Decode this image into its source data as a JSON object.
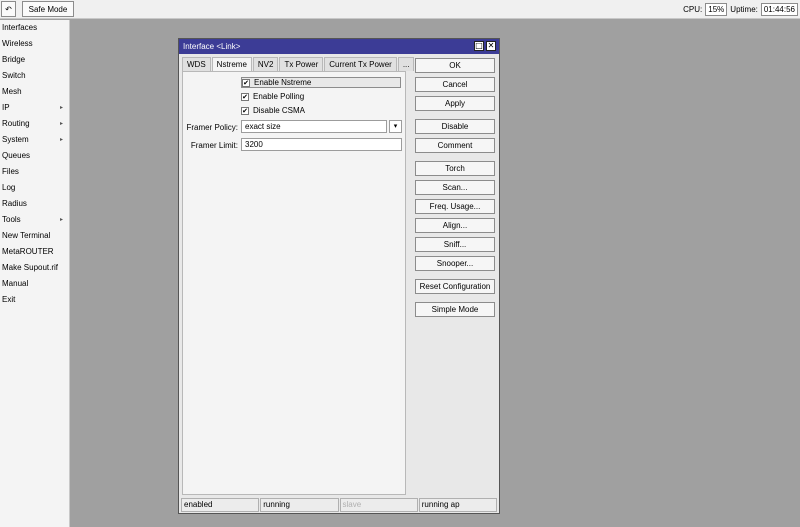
{
  "toolbar": {
    "undo_icon": "undo-icon",
    "undo_glyph": "↶",
    "safe_mode_label": "Safe Mode",
    "cpu_label": "CPU:",
    "cpu_value": "15%",
    "uptime_label": "Uptime:",
    "uptime_value": "01:44:56"
  },
  "sidebar": {
    "items": [
      {
        "label": "Interfaces",
        "submenu": false
      },
      {
        "label": "Wireless",
        "submenu": false
      },
      {
        "label": "Bridge",
        "submenu": false
      },
      {
        "label": "Switch",
        "submenu": false
      },
      {
        "label": "Mesh",
        "submenu": false
      },
      {
        "label": "IP",
        "submenu": true
      },
      {
        "label": "Routing",
        "submenu": true
      },
      {
        "label": "System",
        "submenu": true
      },
      {
        "label": "Queues",
        "submenu": false
      },
      {
        "label": "Files",
        "submenu": false
      },
      {
        "label": "Log",
        "submenu": false
      },
      {
        "label": "Radius",
        "submenu": false
      },
      {
        "label": "Tools",
        "submenu": true
      },
      {
        "label": "New Terminal",
        "submenu": false
      },
      {
        "label": "MetaROUTER",
        "submenu": false
      },
      {
        "label": "Make Supout.rif",
        "submenu": false
      },
      {
        "label": "Manual",
        "submenu": false
      },
      {
        "label": "Exit",
        "submenu": false
      }
    ],
    "arrow_glyph": "▸"
  },
  "window": {
    "title": "Interface <Link>",
    "restore_glyph": "□",
    "close_glyph": "✕",
    "tabs": [
      "WDS",
      "Nstreme",
      "NV2",
      "Tx Power",
      "Current Tx Power",
      "..."
    ],
    "active_tab": "Nstreme",
    "checkboxes": [
      {
        "label": "Enable Nstreme",
        "checked": true
      },
      {
        "label": "Enable Polling",
        "checked": true
      },
      {
        "label": "Disable CSMA",
        "checked": true
      }
    ],
    "check_glyph": "✔",
    "framer_policy": {
      "label": "Framer Policy:",
      "value": "exact size",
      "dropdown_glyph": "▾"
    },
    "framer_limit": {
      "label": "Framer Limit:",
      "value": "3200"
    },
    "buttons": {
      "ok": "OK",
      "cancel": "Cancel",
      "apply": "Apply",
      "disable": "Disable",
      "comment": "Comment",
      "torch": "Torch",
      "scan": "Scan...",
      "freq_usage": "Freq. Usage...",
      "align": "Align...",
      "sniff": "Sniff...",
      "snooper": "Snooper...",
      "reset_configuration": "Reset Configuration",
      "simple_mode": "Simple Mode"
    },
    "status": [
      "enabled",
      "running",
      "slave",
      "running ap"
    ]
  }
}
